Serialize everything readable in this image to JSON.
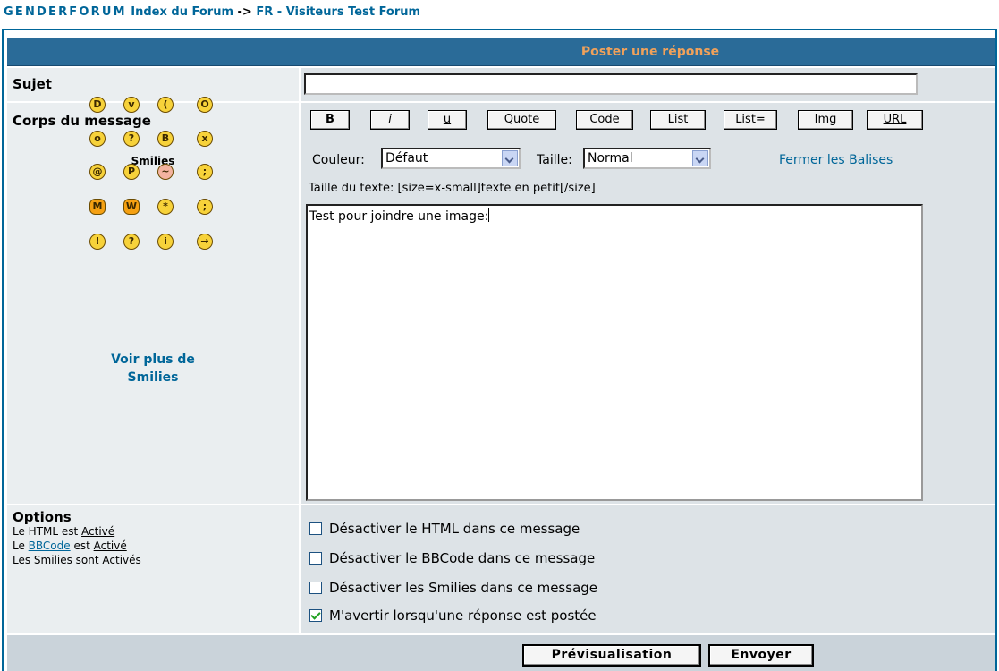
{
  "breadcrumb": {
    "site": "GENDERFORUM",
    "index": "Index du Forum",
    "arrow": "->",
    "forum": "FR - Visiteurs Test Forum"
  },
  "header": {
    "title": "Poster une réponse"
  },
  "subject": {
    "label": "Sujet",
    "value": ""
  },
  "body": {
    "label": "Corps du message",
    "bbcode_buttons": [
      "B",
      "i",
      "u",
      "Quote",
      "Code",
      "List",
      "List=",
      "Img",
      "URL"
    ],
    "color_label": "Couleur:",
    "color_value": "Défaut",
    "size_label": "Taille:",
    "size_value": "Normal",
    "close_tags": "Fermer les Balises",
    "hint": "Taille du texte: [size=x-small]texte en petit[/size]",
    "message": "Test pour joindre une image:"
  },
  "smilies": {
    "title": "Smilies",
    "more": [
      "Voir plus de",
      "Smilies"
    ],
    "icons": [
      "big-grin-smiley-icon",
      "grin-smiley-icon",
      "sad-smiley-icon",
      "shocked-smiley-icon",
      "eek-smiley-icon",
      "confused-smiley-icon",
      "cool-smiley-icon",
      "laughing-smiley-icon",
      "mad-smiley-icon",
      "razz-smiley-icon",
      "embarrassed-smiley-icon",
      "crying-smiley-icon",
      "evil-smiley-icon",
      "twisted-evil-smiley-icon",
      "rolling-eyes-smiley-icon",
      "wink-smiley-icon",
      "exclamation-smiley-icon",
      "question-smiley-icon",
      "idea-smiley-icon",
      "arrow-smiley-icon"
    ]
  },
  "options": {
    "title": "Options",
    "html": {
      "prefix": "Le HTML est ",
      "status": "Activé"
    },
    "bbcode": {
      "prefix": "Le ",
      "link": "BBCode",
      "middle": " est ",
      "status": "Activé"
    },
    "smilies": {
      "prefix": "Les Smilies sont ",
      "status": "Activés"
    },
    "checkboxes": [
      {
        "label": "Désactiver le HTML dans ce message",
        "checked": false
      },
      {
        "label": "Désactiver le BBCode dans ce message",
        "checked": false
      },
      {
        "label": "Désactiver les Smilies dans ce message",
        "checked": false
      },
      {
        "label": "M'avertir lorsqu'une réponse est postée",
        "checked": true
      }
    ]
  },
  "actions": {
    "preview": "Prévisualisation",
    "submit": "Envoyer"
  }
}
